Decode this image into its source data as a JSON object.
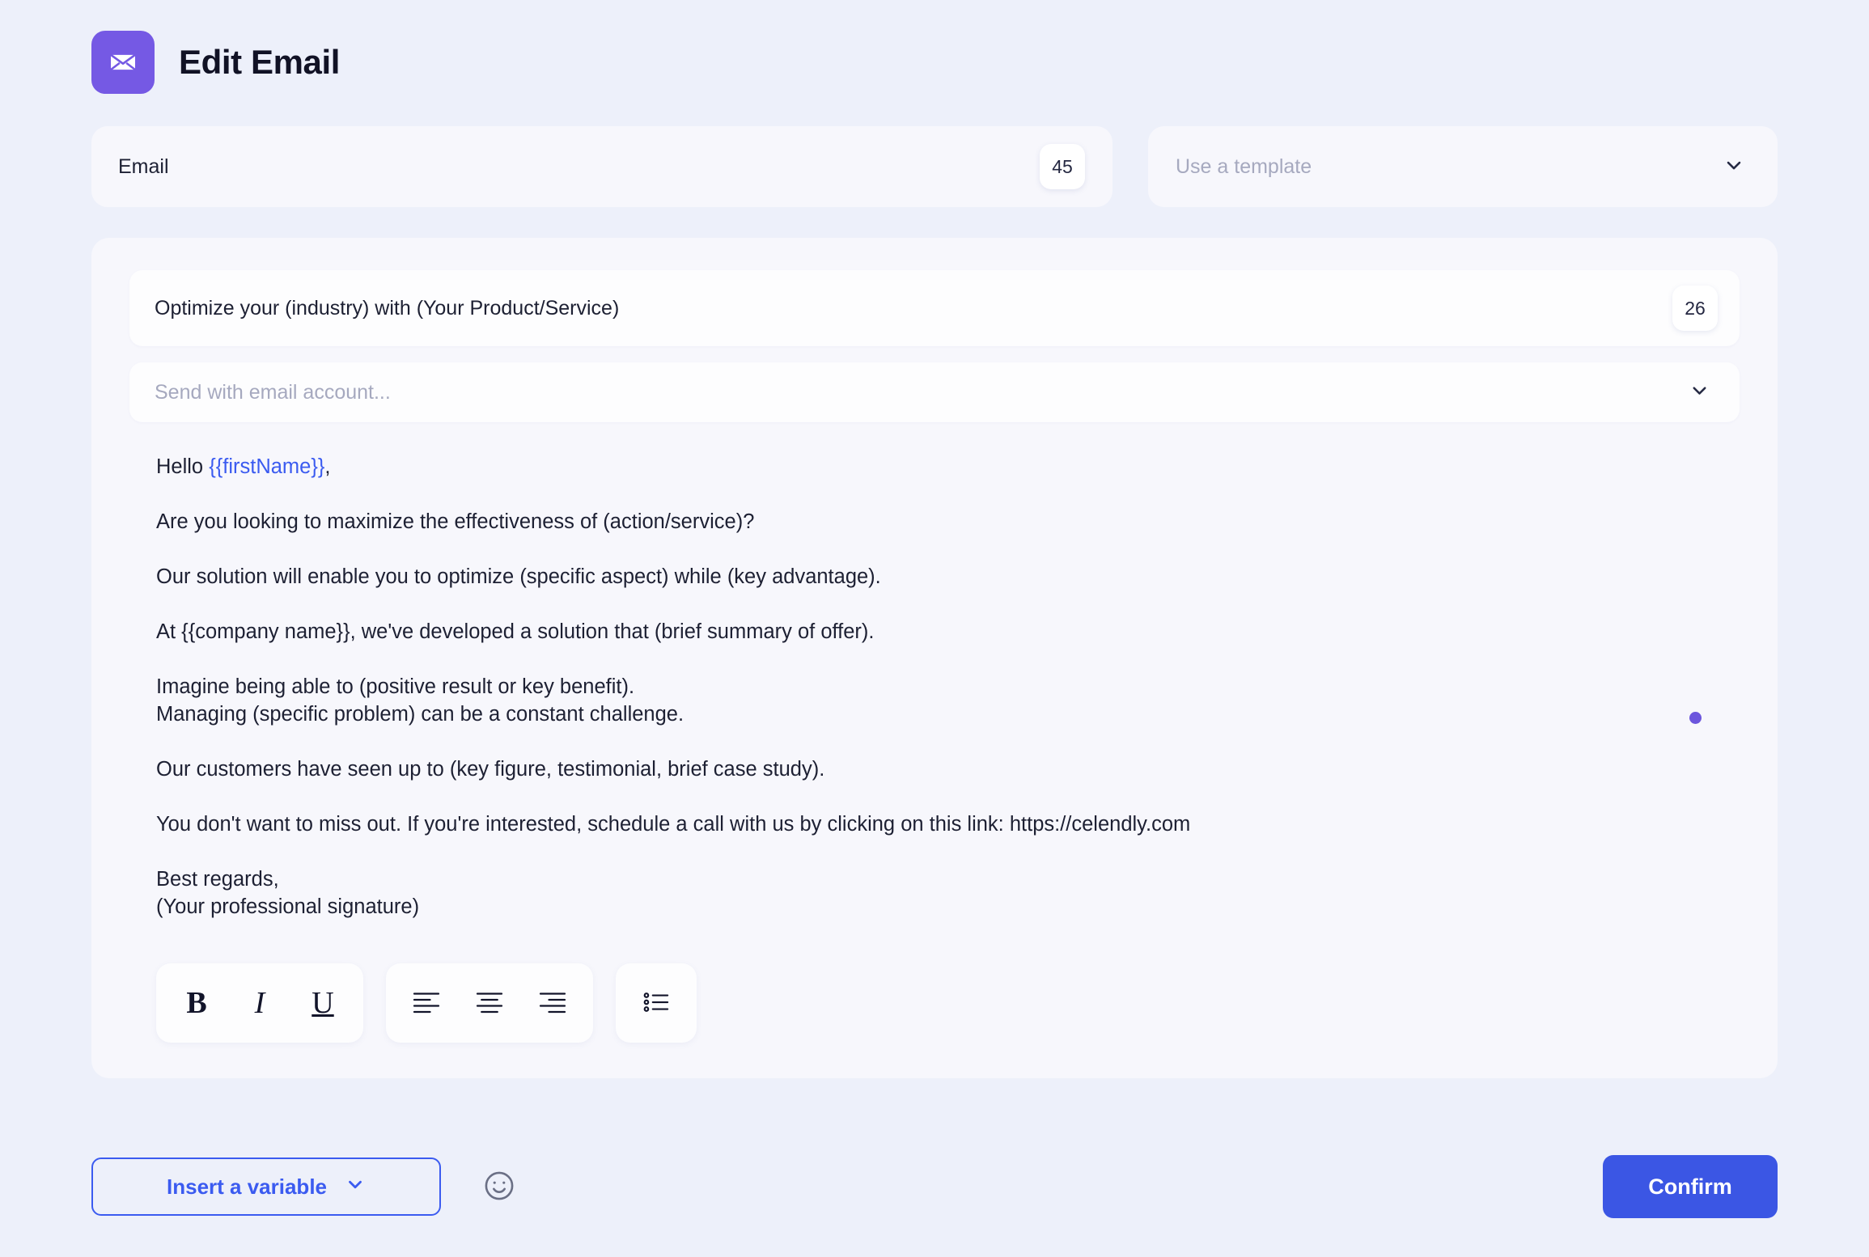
{
  "header": {
    "title": "Edit Email",
    "icon": "envelope-icon"
  },
  "email_name": {
    "value": "Email",
    "count": "45"
  },
  "template_select": {
    "placeholder": "Use a template",
    "chevron": "chevron-down-icon"
  },
  "subject": {
    "value": "Optimize your (industry) with (Your Product/Service)",
    "count": "26"
  },
  "account_select": {
    "placeholder": "Send with email account...",
    "chevron": "chevron-down-icon"
  },
  "body": {
    "greeting_prefix": "Hello ",
    "greeting_variable": "{{firstName}}",
    "greeting_suffix": ",",
    "paragraphs": [
      "Are you looking to maximize the effectiveness of (action/service)?",
      "Our solution will enable you to optimize (specific aspect) while (key advantage).",
      "At {{company name}}, we've developed a solution that (brief summary of offer).",
      "Imagine being able to (positive result or key benefit).\nManaging (specific problem) can be a constant challenge.",
      "Our customers have seen up to (key figure, testimonial, brief case study).",
      "You don't want to miss out. If you're interested, schedule a call with us by clicking on this link: https://celendly.com",
      "Best regards,\n(Your professional signature)"
    ]
  },
  "toolbar": {
    "groups": [
      {
        "name": "text-style",
        "buttons": [
          {
            "name": "bold-button",
            "glyph": "B",
            "style": "bold"
          },
          {
            "name": "italic-button",
            "glyph": "I",
            "style": "italic"
          },
          {
            "name": "underline-button",
            "glyph": "U",
            "style": "underline"
          }
        ]
      },
      {
        "name": "alignment",
        "buttons": [
          {
            "name": "align-left-button",
            "glyph": "align-left-icon"
          },
          {
            "name": "align-center-button",
            "glyph": "align-center-icon"
          },
          {
            "name": "align-right-button",
            "glyph": "align-right-icon"
          }
        ]
      },
      {
        "name": "list",
        "buttons": [
          {
            "name": "bulleted-list-button",
            "glyph": "bulleted-list-icon"
          }
        ]
      }
    ]
  },
  "footer": {
    "insert_variable_label": "Insert a variable",
    "insert_variable_chevron": "chevron-down-icon",
    "emoji_icon": "smiley-face-icon",
    "confirm_label": "Confirm"
  },
  "colors": {
    "page_background": "#edf0fa",
    "card_background": "#f7f7fc",
    "field_background": "#fdfdfe",
    "brand_purple": "#7559e4",
    "accent_blue": "#3b5bf0",
    "confirm_blue": "#3b56e4",
    "text_dark": "#1d2033",
    "placeholder_grey": "#a6a9bf",
    "dot_purple": "#6c56dd"
  }
}
